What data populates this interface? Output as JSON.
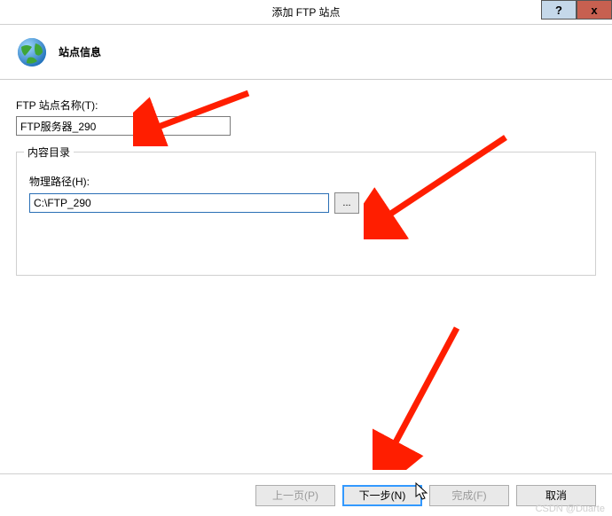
{
  "titlebar": {
    "title": "添加 FTP 站点",
    "help_label": "?",
    "close_label": "x"
  },
  "header": {
    "title": "站点信息"
  },
  "form": {
    "site_name_label": "FTP 站点名称(T):",
    "site_name_value": "FTP服务器_290",
    "content_dir_legend": "内容目录",
    "physical_path_label": "物理路径(H):",
    "physical_path_value": "C:\\FTP_290",
    "browse_label": "..."
  },
  "footer": {
    "prev_label": "上一页(P)",
    "next_label": "下一步(N)",
    "finish_label": "完成(F)",
    "cancel_label": "取消"
  },
  "watermark": "CSDN @Duarte"
}
